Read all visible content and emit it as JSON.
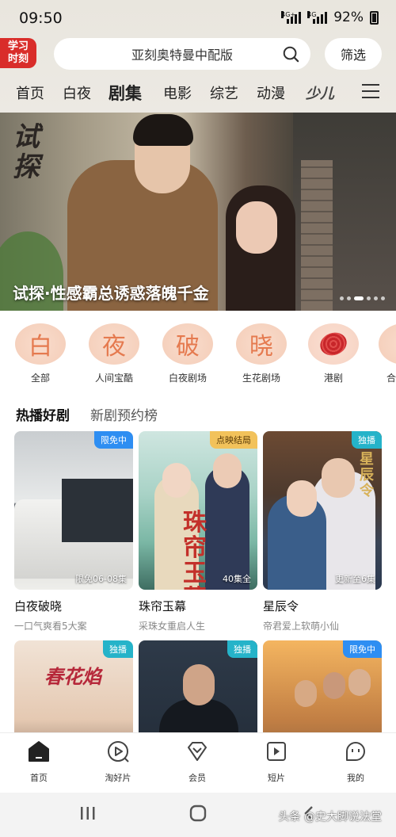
{
  "status": {
    "time": "09:50",
    "battery": "92%",
    "sig1": "4G+",
    "sig2": "4G"
  },
  "logo": {
    "line1": "学习",
    "line2": "时刻"
  },
  "search": {
    "placeholder": "亚刻奥特曼中配版"
  },
  "filter_label": "筛选",
  "nav": {
    "tabs": [
      "首页",
      "白夜",
      "剧集",
      "电影",
      "综艺",
      "动漫"
    ],
    "kids": "少儿",
    "active_index": 2
  },
  "banner": {
    "calligraphy": "试探",
    "caption": "试探·性感霸总诱惑落魄千金",
    "dot_count": 6,
    "active_dot": 2
  },
  "categories": [
    {
      "glyph": "白",
      "label": "全部"
    },
    {
      "glyph": "夜",
      "label": "人间宝酷"
    },
    {
      "glyph": "破",
      "label": "白夜剧场"
    },
    {
      "glyph": "晓",
      "label": "生花剧场"
    },
    {
      "glyph": "",
      "label": "港剧"
    },
    {
      "glyph": "",
      "label": "合"
    }
  ],
  "sections": {
    "active": "热播好剧",
    "inactive": "新剧预约榜"
  },
  "cards": [
    {
      "title": "白夜破晓",
      "subtitle": "一口气爽看5大案",
      "badge": "限免中",
      "badge_color": "#2e8ef2",
      "episode": "限免06-08集"
    },
    {
      "title": "珠帘玉幕",
      "subtitle": "采珠女重启人生",
      "badge": "点映结局",
      "badge_color": "#f2c25b",
      "episode": "40集全",
      "poster_text": "珠帘玉幕"
    },
    {
      "title": "星辰令",
      "subtitle": "帝君爱上软萌小仙",
      "badge": "独播",
      "badge_color": "#25b3c9",
      "episode": "更新至6集",
      "poster_text": "星辰令"
    },
    {
      "badge": "独播",
      "badge_color": "#25b3c9",
      "poster_text": "春花焰"
    },
    {
      "badge": "独播",
      "badge_color": "#25b3c9"
    },
    {
      "badge": "限免中",
      "badge_color": "#2e8ef2"
    }
  ],
  "tabbar": [
    {
      "label": "首页",
      "icon": "home-icon"
    },
    {
      "label": "淘好片",
      "icon": "play-circle-icon"
    },
    {
      "label": "会员",
      "icon": "vip-diamond-icon"
    },
    {
      "label": "短片",
      "icon": "short-video-icon"
    },
    {
      "label": "我的",
      "icon": "profile-icon"
    }
  ],
  "watermark": "头条 @史大脚说法堂"
}
